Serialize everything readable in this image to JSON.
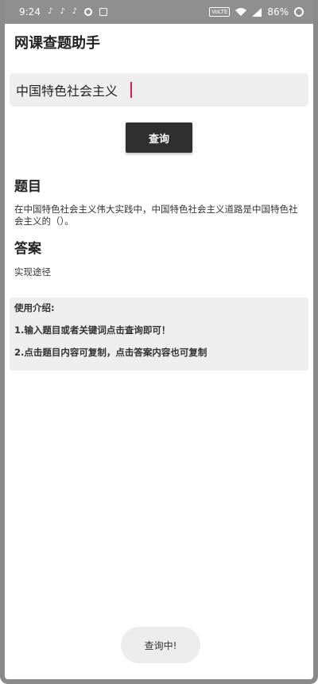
{
  "status_bar": {
    "time": "9:24",
    "notification_icons": [
      "tiktok-icon",
      "tiktok-icon",
      "tiktok-icon",
      "circle-icon",
      "calendar-icon"
    ],
    "network_label": "VoLTE",
    "battery": "86%"
  },
  "app": {
    "title": "网课查题助手"
  },
  "search": {
    "value": "中国特色社会主义"
  },
  "query_button": {
    "label": "查询"
  },
  "question": {
    "heading": "题目",
    "text": "在中国特色社会主义伟大实践中，中国特色社会主义道路是中国特色社会主义的（）。"
  },
  "answer": {
    "heading": "答案",
    "text": "实现途径"
  },
  "intro": {
    "title": "使用介绍:",
    "line1": "1.输入题目或者关键词点击查询即可！",
    "line2": "2.点击题目内容可复制，点击答案内容也可复制"
  },
  "toast": {
    "text": "查询中!"
  }
}
